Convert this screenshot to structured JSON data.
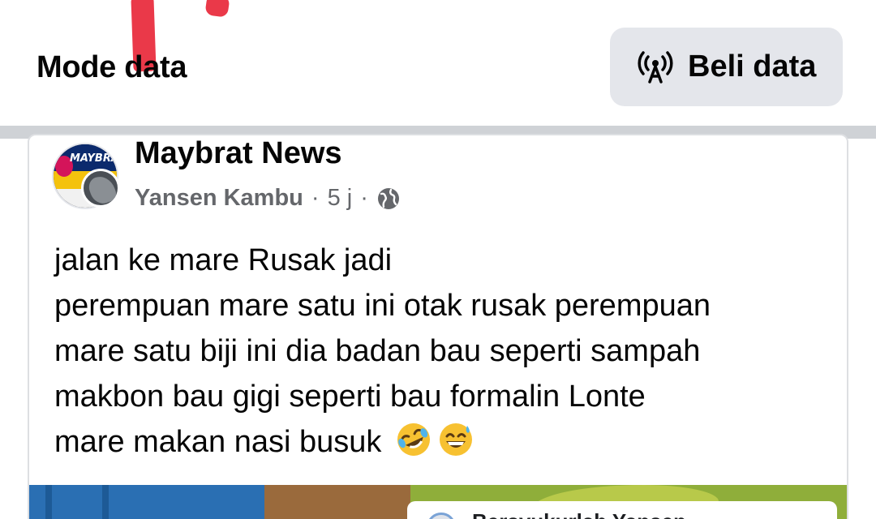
{
  "topbar": {
    "mode_label": "Mode data",
    "buy_button_label": "Beli data",
    "buy_icon": "antenna-icon"
  },
  "post": {
    "page_name": "Maybrat News",
    "author": "Yansen Kambu",
    "separator": "·",
    "time": "5 j",
    "privacy_icon": "globe-icon",
    "avatar_logo_text": "MAYBRA",
    "text_lines": [
      "jalan ke mare Rusak jadi",
      "perempuan mare satu ini otak rusak perempuan",
      "mare satu biji ini dia badan bau seperti sampah",
      "makbon bau gigi seperti bau formalin Lonte",
      "mare makan nasi busuk"
    ],
    "emojis": [
      "rolling-on-floor-laughing-emoji",
      "grinning-sweat-emoji"
    ]
  },
  "photo": {
    "overlay_text": "Bersyukurlah Yansen"
  },
  "colors": {
    "secondary_text": "#65676b",
    "button_bg": "#e4e6eb",
    "divider": "#cfd2d6",
    "red_mark": "#e8283a"
  }
}
